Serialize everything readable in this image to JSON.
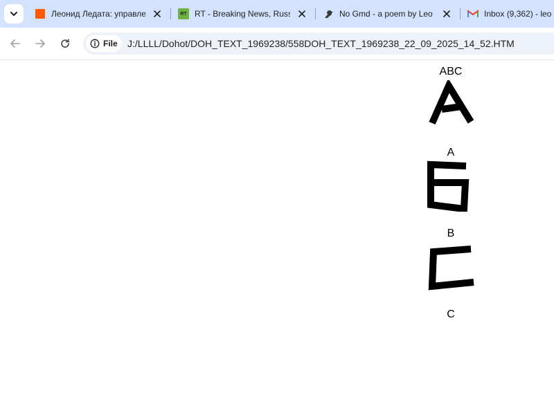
{
  "browser": {
    "tabs": [
      {
        "title": "Леонид Ледата: управлен",
        "favicon": "orange-square-icon"
      },
      {
        "title": "RT - Breaking News, Russia",
        "favicon": "rt-logo-icon"
      },
      {
        "title": "No Gmd - a poem by Leo",
        "favicon": "crow-icon"
      },
      {
        "title": "Inbox (9,362) - leo",
        "favicon": "gmail-icon"
      }
    ],
    "address": {
      "chip_label": "File",
      "url": "J:/LLLL/Dohot/DOH_TEXT_1969238/558DOH_TEXT_1969238_22_09_2025_14_52.HTM"
    },
    "favicon_text": {
      "rt": "RT"
    }
  },
  "page": {
    "heading": "ABC",
    "glyphs": [
      {
        "name": "A",
        "label": "A"
      },
      {
        "name": "B",
        "label": "B"
      },
      {
        "name": "C",
        "label": "C"
      }
    ]
  },
  "colors": {
    "tabstrip_bg": "#d3e3fd",
    "omnibox_bg": "#edf2fa",
    "glyph_stroke": "#000000",
    "gmail_red": "#ea4335",
    "rt_green": "#6cb33f",
    "favicon_orange": "#ff5a00"
  }
}
